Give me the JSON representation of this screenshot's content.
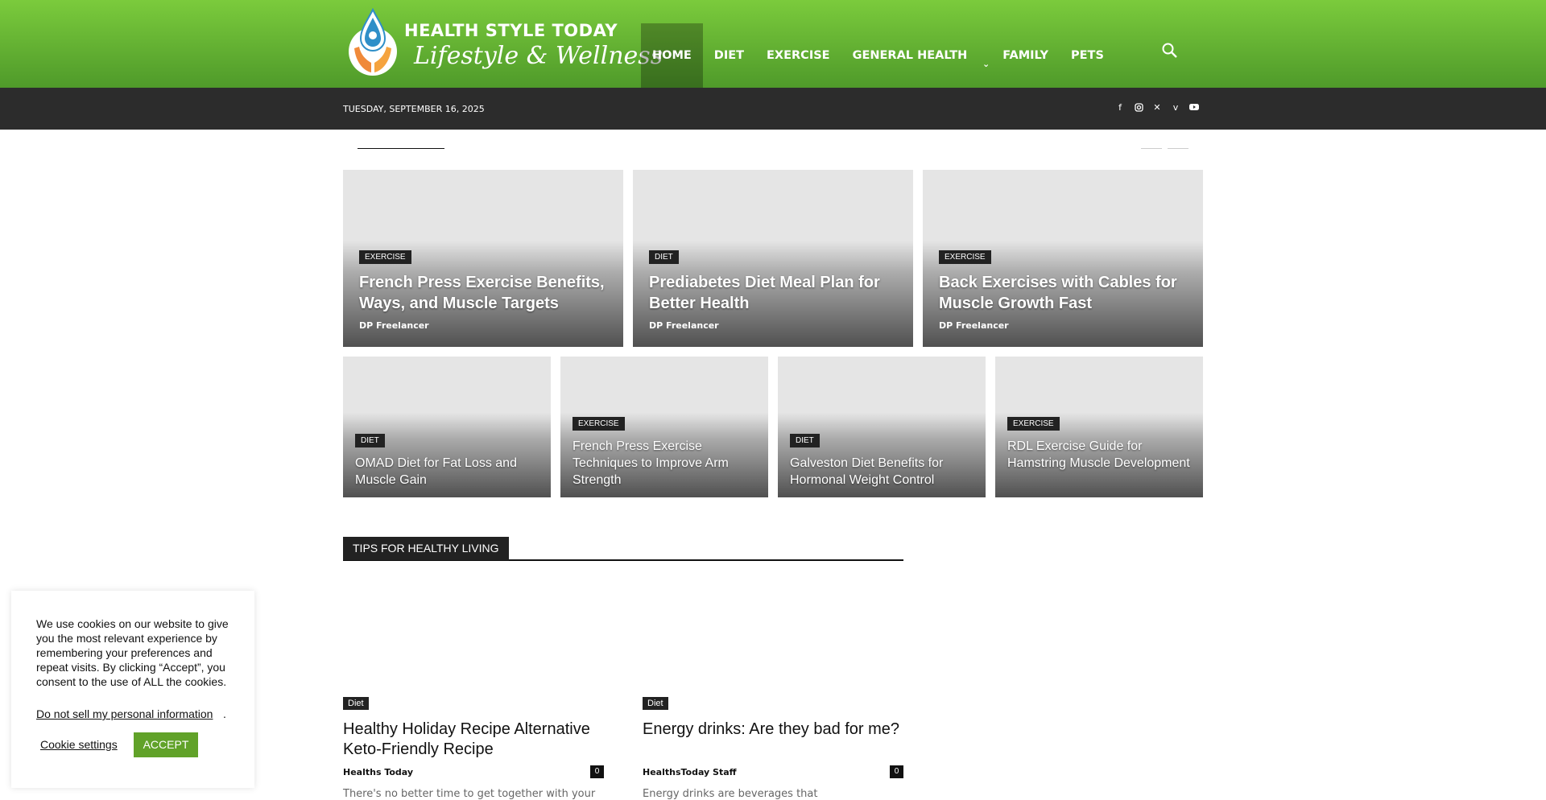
{
  "header": {
    "logo_title": "HEALTH STYLE TODAY",
    "logo_subtitle": "Lifestyle & Wellness",
    "nav": [
      {
        "label": "HOME",
        "active": true
      },
      {
        "label": "DIET"
      },
      {
        "label": "EXERCISE"
      },
      {
        "label": "GENERAL HEALTH",
        "dropdown": true
      },
      {
        "label": "FAMILY"
      },
      {
        "label": "PETS"
      }
    ],
    "search_icon": "search-icon",
    "accent_color": "#6cbd36"
  },
  "subbar": {
    "date": "TUESDAY, SEPTEMBER 16, 2025",
    "socials": [
      "facebook-icon",
      "instagram-icon",
      "x-icon",
      "vimeo-icon",
      "youtube-icon"
    ]
  },
  "featured_big": [
    {
      "category": "EXERCISE",
      "title": "French Press Exercise Benefits, Ways, and Muscle Targets",
      "author": "DP Freelancer"
    },
    {
      "category": "DIET",
      "title": "Prediabetes Diet Meal Plan for Better Health",
      "author": "DP Freelancer"
    },
    {
      "category": "EXERCISE",
      "title": "Back Exercises with Cables for Muscle Growth Fast",
      "author": "DP Freelancer"
    }
  ],
  "featured_small": [
    {
      "category": "DIET",
      "title": "OMAD Diet for Fat Loss and Muscle Gain"
    },
    {
      "category": "EXERCISE",
      "title": "French Press Exercise Techniques to Improve Arm Strength"
    },
    {
      "category": "DIET",
      "title": "Galveston Diet Benefits for Hormonal Weight Control"
    },
    {
      "category": "EXERCISE",
      "title": "RDL Exercise Guide for Hamstring Muscle Development"
    }
  ],
  "tips": {
    "title": "TIPS FOR HEALTHY LIVING",
    "posts": [
      {
        "category": "Diet",
        "title": "Healthy Holiday Recipe Alternative Keto-Friendly Recipe",
        "author": "Healths Today",
        "comments": "0",
        "excerpt": "There's no better time to get together with your"
      },
      {
        "category": "Diet",
        "title": "Energy drinks:  Are they bad for me?",
        "author": "HealthsToday Staff",
        "comments": "0",
        "excerpt": "Energy drinks are beverages that"
      }
    ]
  },
  "cookie": {
    "text": "We use cookies on our website to give you the most relevant experience by remembering your preferences and repeat visits. By clicking “Accept”, you consent to the use of ALL the cookies.",
    "dnsmpi": "Do not sell my personal information",
    "dot": ".",
    "settings": "Cookie settings",
    "accept": "ACCEPT",
    "accept_color": "#61a229"
  }
}
